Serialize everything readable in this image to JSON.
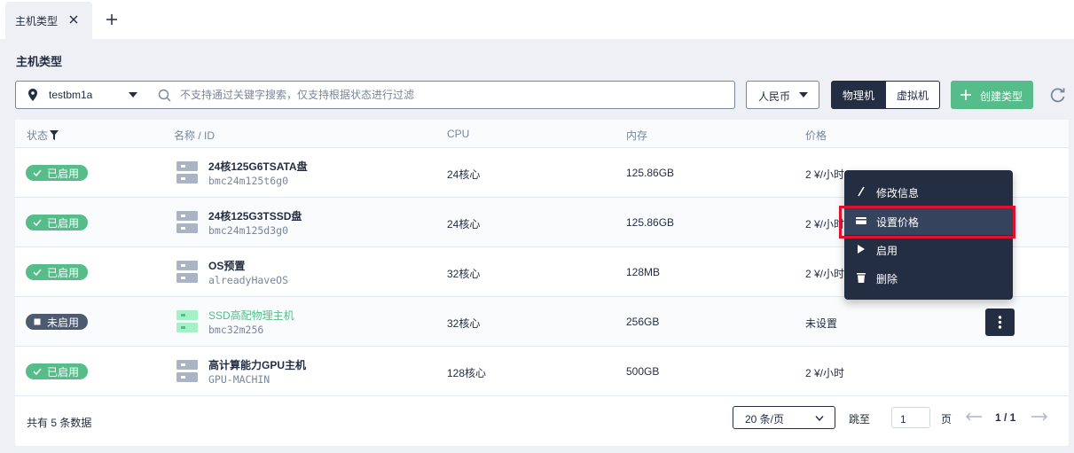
{
  "tabs": [
    {
      "label": "主机类型"
    }
  ],
  "page": {
    "title": "主机类型"
  },
  "toolbar": {
    "zone": "testbm1a",
    "search_placeholder": "不支持通过关键字搜索，仅支持根据状态进行过滤",
    "currency": "人民币",
    "physical": "物理机",
    "virtual": "虚拟机",
    "create": "创建类型"
  },
  "table": {
    "headers": {
      "status": "状态",
      "name": "名称 / ID",
      "cpu": "CPU",
      "memory": "内存",
      "price": "价格"
    },
    "rows": [
      {
        "status": "已启用",
        "name": "24核125G6TSATA盘",
        "id": "bmc24m125t6g0",
        "cpu": "24核心",
        "memory": "125.86GB",
        "price": "2 ¥/小时"
      },
      {
        "status": "已启用",
        "name": "24核125G3TSSD盘",
        "id": "bmc24m125d3g0",
        "cpu": "24核心",
        "memory": "125.86GB",
        "price": "2 ¥/小时"
      },
      {
        "status": "已启用",
        "name": "OS预置",
        "id": "alreadyHaveOS",
        "cpu": "32核心",
        "memory": "128MB",
        "price": "2 ¥/小时"
      },
      {
        "status": "未启用",
        "name": "SSD高配物理主机",
        "id": "bmc32m256",
        "cpu": "32核心",
        "memory": "256GB",
        "price": "未设置"
      },
      {
        "status": "已启用",
        "name": "高计算能力GPU主机",
        "id": "GPU-MACHIN",
        "cpu": "128核心",
        "memory": "500GB",
        "price": "2 ¥/小时"
      }
    ]
  },
  "footer": {
    "total": "共有 5 条数据",
    "page_size": "20 条/页",
    "jump": "跳至",
    "page_input": "1",
    "page_unit": "页",
    "page_num": "1 / 1"
  },
  "menu": {
    "items": [
      {
        "label": "修改信息",
        "icon": "pencil-icon"
      },
      {
        "label": "设置价格",
        "icon": "card-icon"
      },
      {
        "label": "启用",
        "icon": "play-icon"
      },
      {
        "label": "删除",
        "icon": "trash-icon"
      }
    ]
  },
  "colors": {
    "accent": "#55bc8a",
    "dark": "#242e42",
    "highlight": "#e0102e"
  }
}
